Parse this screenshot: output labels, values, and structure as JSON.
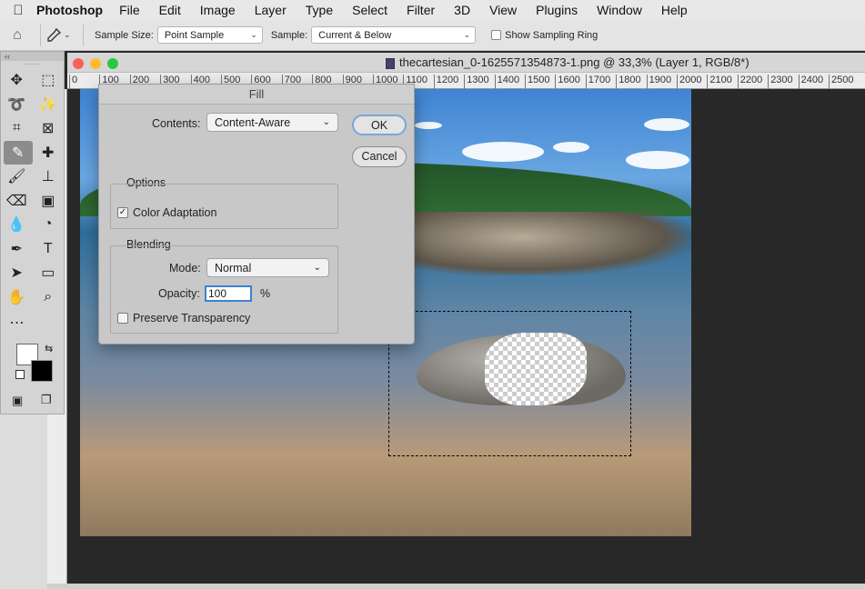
{
  "menubar": {
    "app_name": "Photoshop",
    "items": [
      "File",
      "Edit",
      "Image",
      "Layer",
      "Type",
      "Select",
      "Filter",
      "3D",
      "View",
      "Plugins",
      "Window",
      "Help"
    ]
  },
  "options_bar": {
    "sample_size_label": "Sample Size:",
    "sample_size_value": "Point Sample",
    "sample_label": "Sample:",
    "sample_value": "Current & Below",
    "sampling_ring_label": "Show Sampling Ring",
    "sampling_ring_checked": false
  },
  "document": {
    "title": "thecartesian_0-1625571354873-1.png @ 33,3% (Layer 1, RGB/8*)"
  },
  "ruler": {
    "ticks": [
      "0",
      "100",
      "200",
      "300",
      "400",
      "500",
      "600",
      "700",
      "800",
      "900",
      "1000",
      "1100",
      "1200",
      "1300",
      "1400",
      "1500",
      "1600",
      "1700",
      "1800",
      "1900",
      "2000",
      "2100",
      "2200",
      "2300",
      "2400",
      "2500"
    ]
  },
  "tools_panel": {
    "collapse_glyph": "‹‹",
    "tools": [
      [
        "move-tool",
        "marquee-tool"
      ],
      [
        "lasso-tool",
        "magic-wand-tool"
      ],
      [
        "crop-tool",
        "frame-tool"
      ],
      [
        "eyedropper-tool",
        "healing-brush-tool"
      ],
      [
        "brush-tool",
        "clone-stamp-tool"
      ],
      [
        "eraser-tool",
        "gradient-tool"
      ],
      [
        "blur-tool",
        "dodge-tool"
      ],
      [
        "pen-tool",
        "type-tool"
      ],
      [
        "path-selection-tool",
        "rectangle-tool"
      ],
      [
        "hand-tool",
        "zoom-tool"
      ]
    ],
    "active_tool": "eyedropper-tool",
    "foreground_color": "#ffffff",
    "background_color": "#000000"
  },
  "fill_dialog": {
    "title": "Fill",
    "contents_label": "Contents:",
    "contents_value": "Content-Aware",
    "ok_label": "OK",
    "cancel_label": "Cancel",
    "options_title": "Options",
    "color_adaptation_label": "Color Adaptation",
    "color_adaptation_checked": true,
    "blending_title": "Blending",
    "mode_label": "Mode:",
    "mode_value": "Normal",
    "opacity_label": "Opacity:",
    "opacity_value": "100",
    "opacity_unit": "%",
    "preserve_transparency_label": "Preserve Transparency",
    "preserve_transparency_checked": false
  },
  "colors": {
    "workspace": "#282828",
    "accent_focus": "#3b82d6",
    "traffic_close": "#fe5f57",
    "traffic_min": "#febc2e",
    "traffic_max": "#28c840"
  }
}
